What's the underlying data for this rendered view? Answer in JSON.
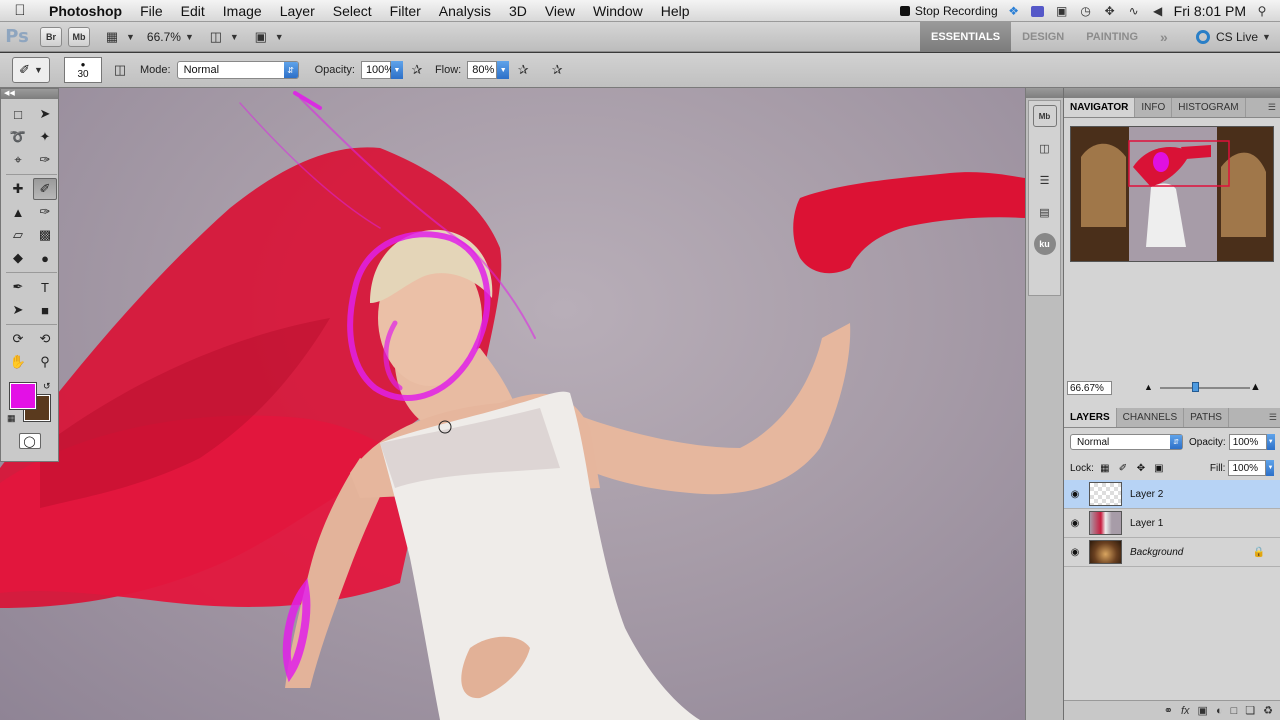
{
  "menubar": {
    "apple_icon": "apple-icon",
    "app_name": "Photoshop",
    "items": [
      "File",
      "Edit",
      "Image",
      "Layer",
      "Select",
      "Filter",
      "Analysis",
      "3D",
      "View",
      "Window",
      "Help"
    ],
    "stop_recording": "Stop Recording",
    "clock": "Fri 8:01 PM"
  },
  "appbar": {
    "logo": "Ps",
    "bridge": "Br",
    "minibridge": "Mb",
    "zoom": "66.7%",
    "workspaces": [
      "ESSENTIALS",
      "DESIGN",
      "PAINTING"
    ],
    "more": "»",
    "cs_live": "CS Live"
  },
  "options": {
    "brush_size": "30",
    "mode_label": "Mode:",
    "mode_value": "Normal",
    "opacity_label": "Opacity:",
    "opacity_value": "100%",
    "flow_label": "Flow:",
    "flow_value": "80%"
  },
  "navigator": {
    "tabs": [
      "NAVIGATOR",
      "INFO",
      "HISTOGRAM"
    ],
    "zoom": "66.67%"
  },
  "layers": {
    "tabs": [
      "LAYERS",
      "CHANNELS",
      "PATHS"
    ],
    "blend_mode": "Normal",
    "opacity_label": "Opacity:",
    "opacity_value": "100%",
    "lock_label": "Lock:",
    "fill_label": "Fill:",
    "fill_value": "100%",
    "items": [
      {
        "name": "Layer 2",
        "selected": true
      },
      {
        "name": "Layer 1",
        "selected": false
      },
      {
        "name": "Background",
        "selected": false
      }
    ]
  },
  "colors": {
    "foreground": "#e310e6",
    "background": "#5a3a1e",
    "scarf": "#e0123a",
    "brush_stroke": "#e020e8"
  },
  "dock": {
    "ku": "ku"
  }
}
